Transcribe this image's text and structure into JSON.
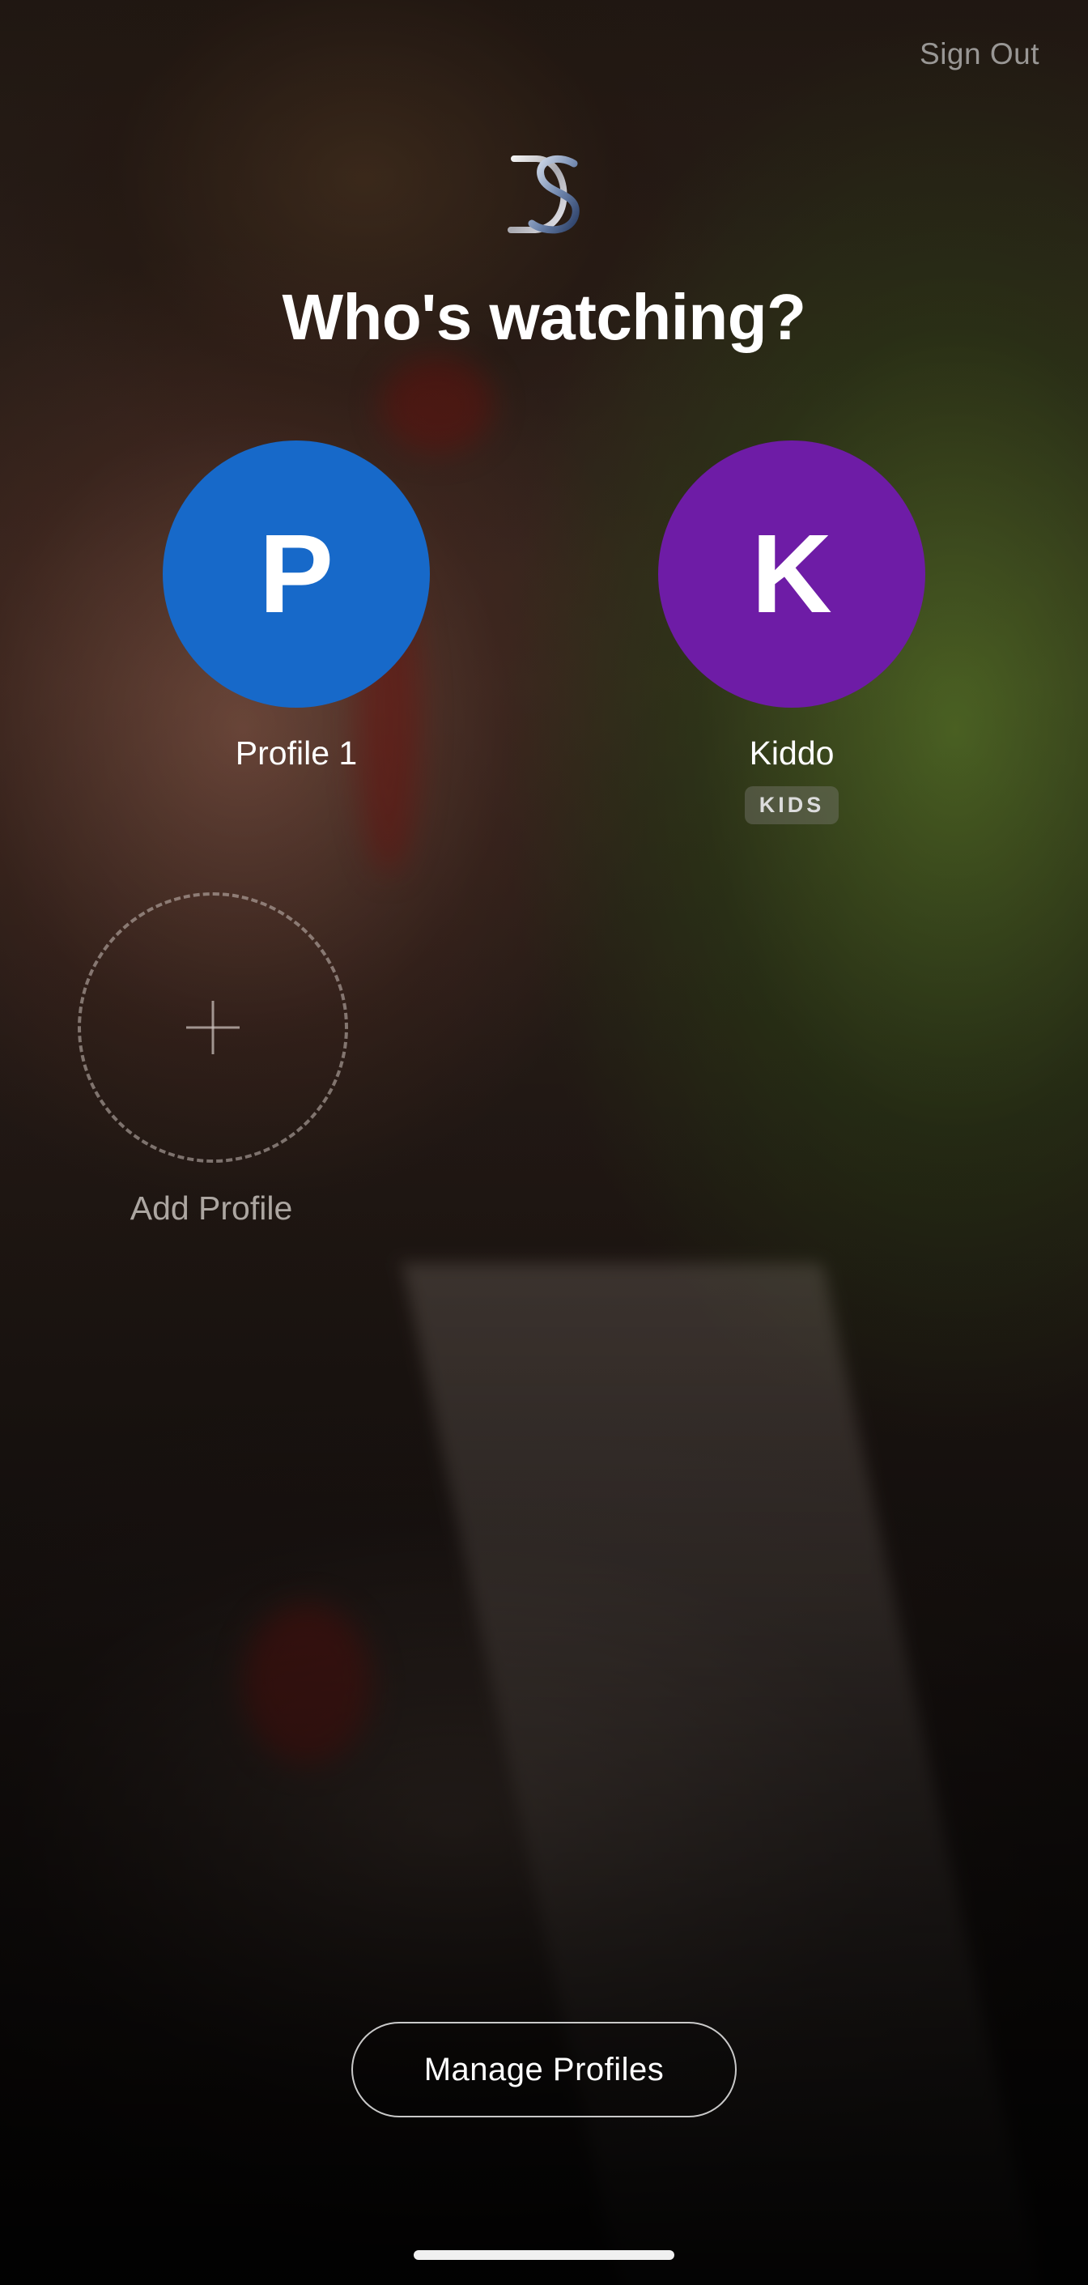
{
  "header": {
    "sign_out_label": "Sign Out",
    "logo_icon": "ds-monogram-logo",
    "title": "Who's watching?"
  },
  "profiles": [
    {
      "initial": "P",
      "name": "Profile 1",
      "color": "#1769C9",
      "badge": ""
    },
    {
      "initial": "K",
      "name": "Kiddo",
      "color": "#6E1CA6",
      "badge": "KIDS"
    }
  ],
  "add_profile": {
    "label": "Add Profile",
    "icon": "plus-icon"
  },
  "footer": {
    "manage_profiles_label": "Manage Profiles"
  },
  "colors": {
    "accent_blue": "#1769C9",
    "accent_purple": "#6E1CA6"
  }
}
